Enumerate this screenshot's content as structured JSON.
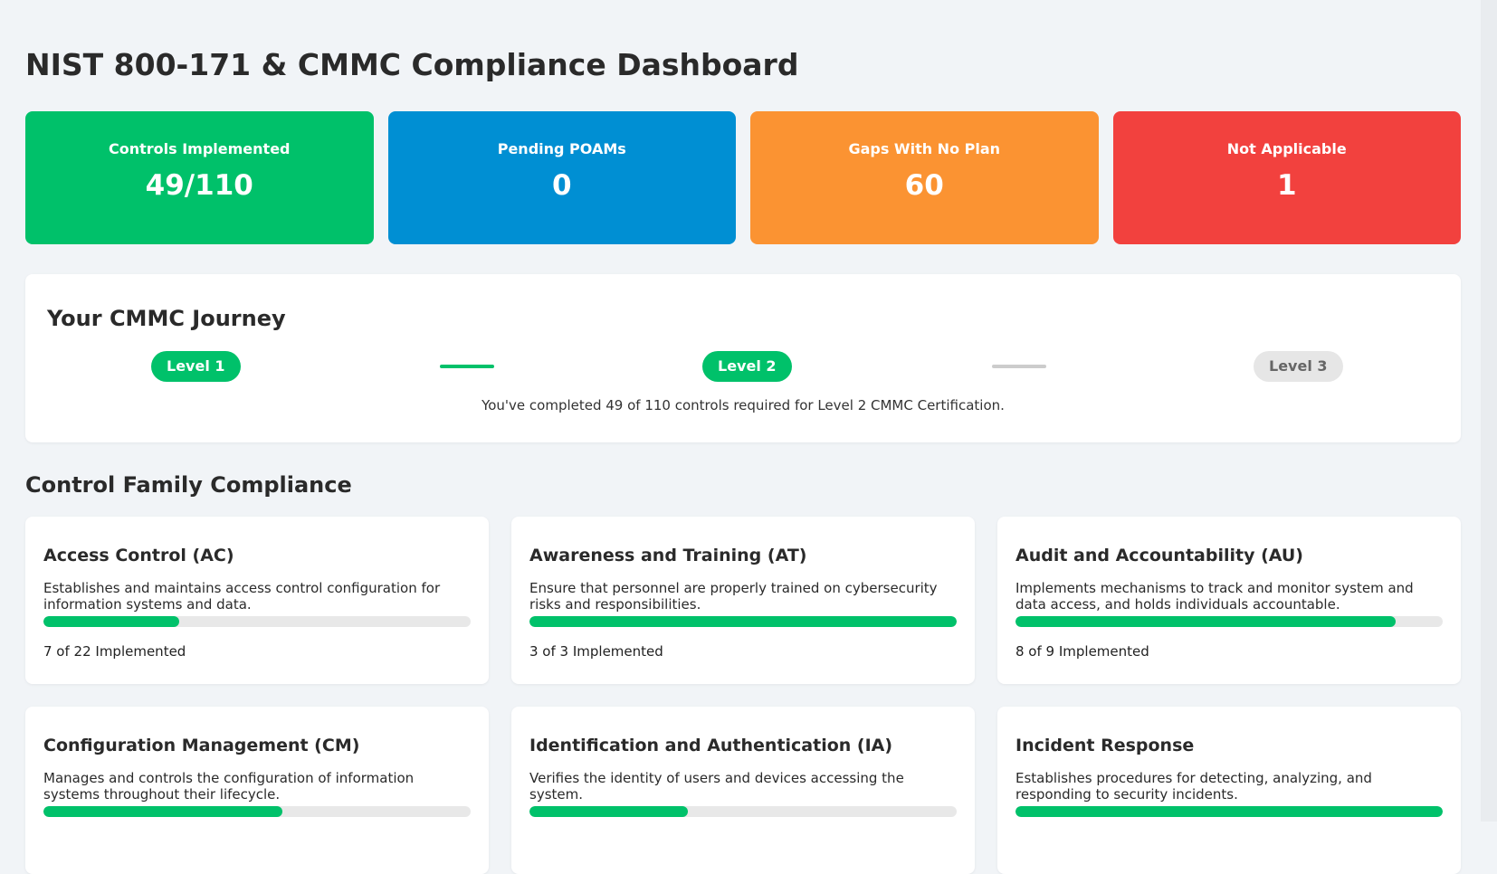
{
  "page": {
    "title": "NIST 800-171 & CMMC Compliance Dashboard"
  },
  "stats": [
    {
      "label": "Controls Implemented",
      "value": "49/110",
      "color": "#00c16a"
    },
    {
      "label": "Pending POAMs",
      "value": "0",
      "color": "#008fd3"
    },
    {
      "label": "Gaps With No Plan",
      "value": "60",
      "color": "#fb9332"
    },
    {
      "label": "Not Applicable",
      "value": "1",
      "color": "#f2413e"
    }
  ],
  "journey": {
    "title": "Your CMMC Journey",
    "levels": [
      {
        "label": "Level 1",
        "status": "complete"
      },
      {
        "label": "Level 2",
        "status": "current"
      },
      {
        "label": "Level 3",
        "status": "pending"
      }
    ],
    "connectors": [
      {
        "status": "complete",
        "color": "#00c16a"
      },
      {
        "status": "pending",
        "color": "#cccccc"
      }
    ],
    "message": "You've completed 49 of 110 controls required for Level 2 CMMC Certification."
  },
  "families_section": {
    "title": "Control Family Compliance",
    "families": [
      {
        "name": "Access Control (AC)",
        "description": "Establishes and maintains access control configuration for information systems and data.",
        "implemented": 7,
        "total": 22,
        "count_text": "7 of 22 Implemented"
      },
      {
        "name": "Awareness and Training (AT)",
        "description": "Ensure that personnel are properly trained on cybersecurity risks and responsibilities.",
        "implemented": 3,
        "total": 3,
        "count_text": "3 of 3 Implemented"
      },
      {
        "name": "Audit and Accountability (AU)",
        "description": "Implements mechanisms to track and monitor system and data access, and holds individuals accountable.",
        "implemented": 8,
        "total": 9,
        "count_text": "8 of 9 Implemented"
      },
      {
        "name": "Configuration Management (CM)",
        "description": "Manages and controls the configuration of information systems throughout their lifecycle.",
        "progress": 0.56,
        "count_text": ""
      },
      {
        "name": "Identification and Authentication (IA)",
        "description": "Verifies the identity of users and devices accessing the system.",
        "progress": 0.37,
        "count_text": ""
      },
      {
        "name": "Incident Response",
        "description": "Establishes procedures for detecting, analyzing, and responding to security incidents.",
        "progress": 1.0,
        "count_text": ""
      }
    ]
  }
}
